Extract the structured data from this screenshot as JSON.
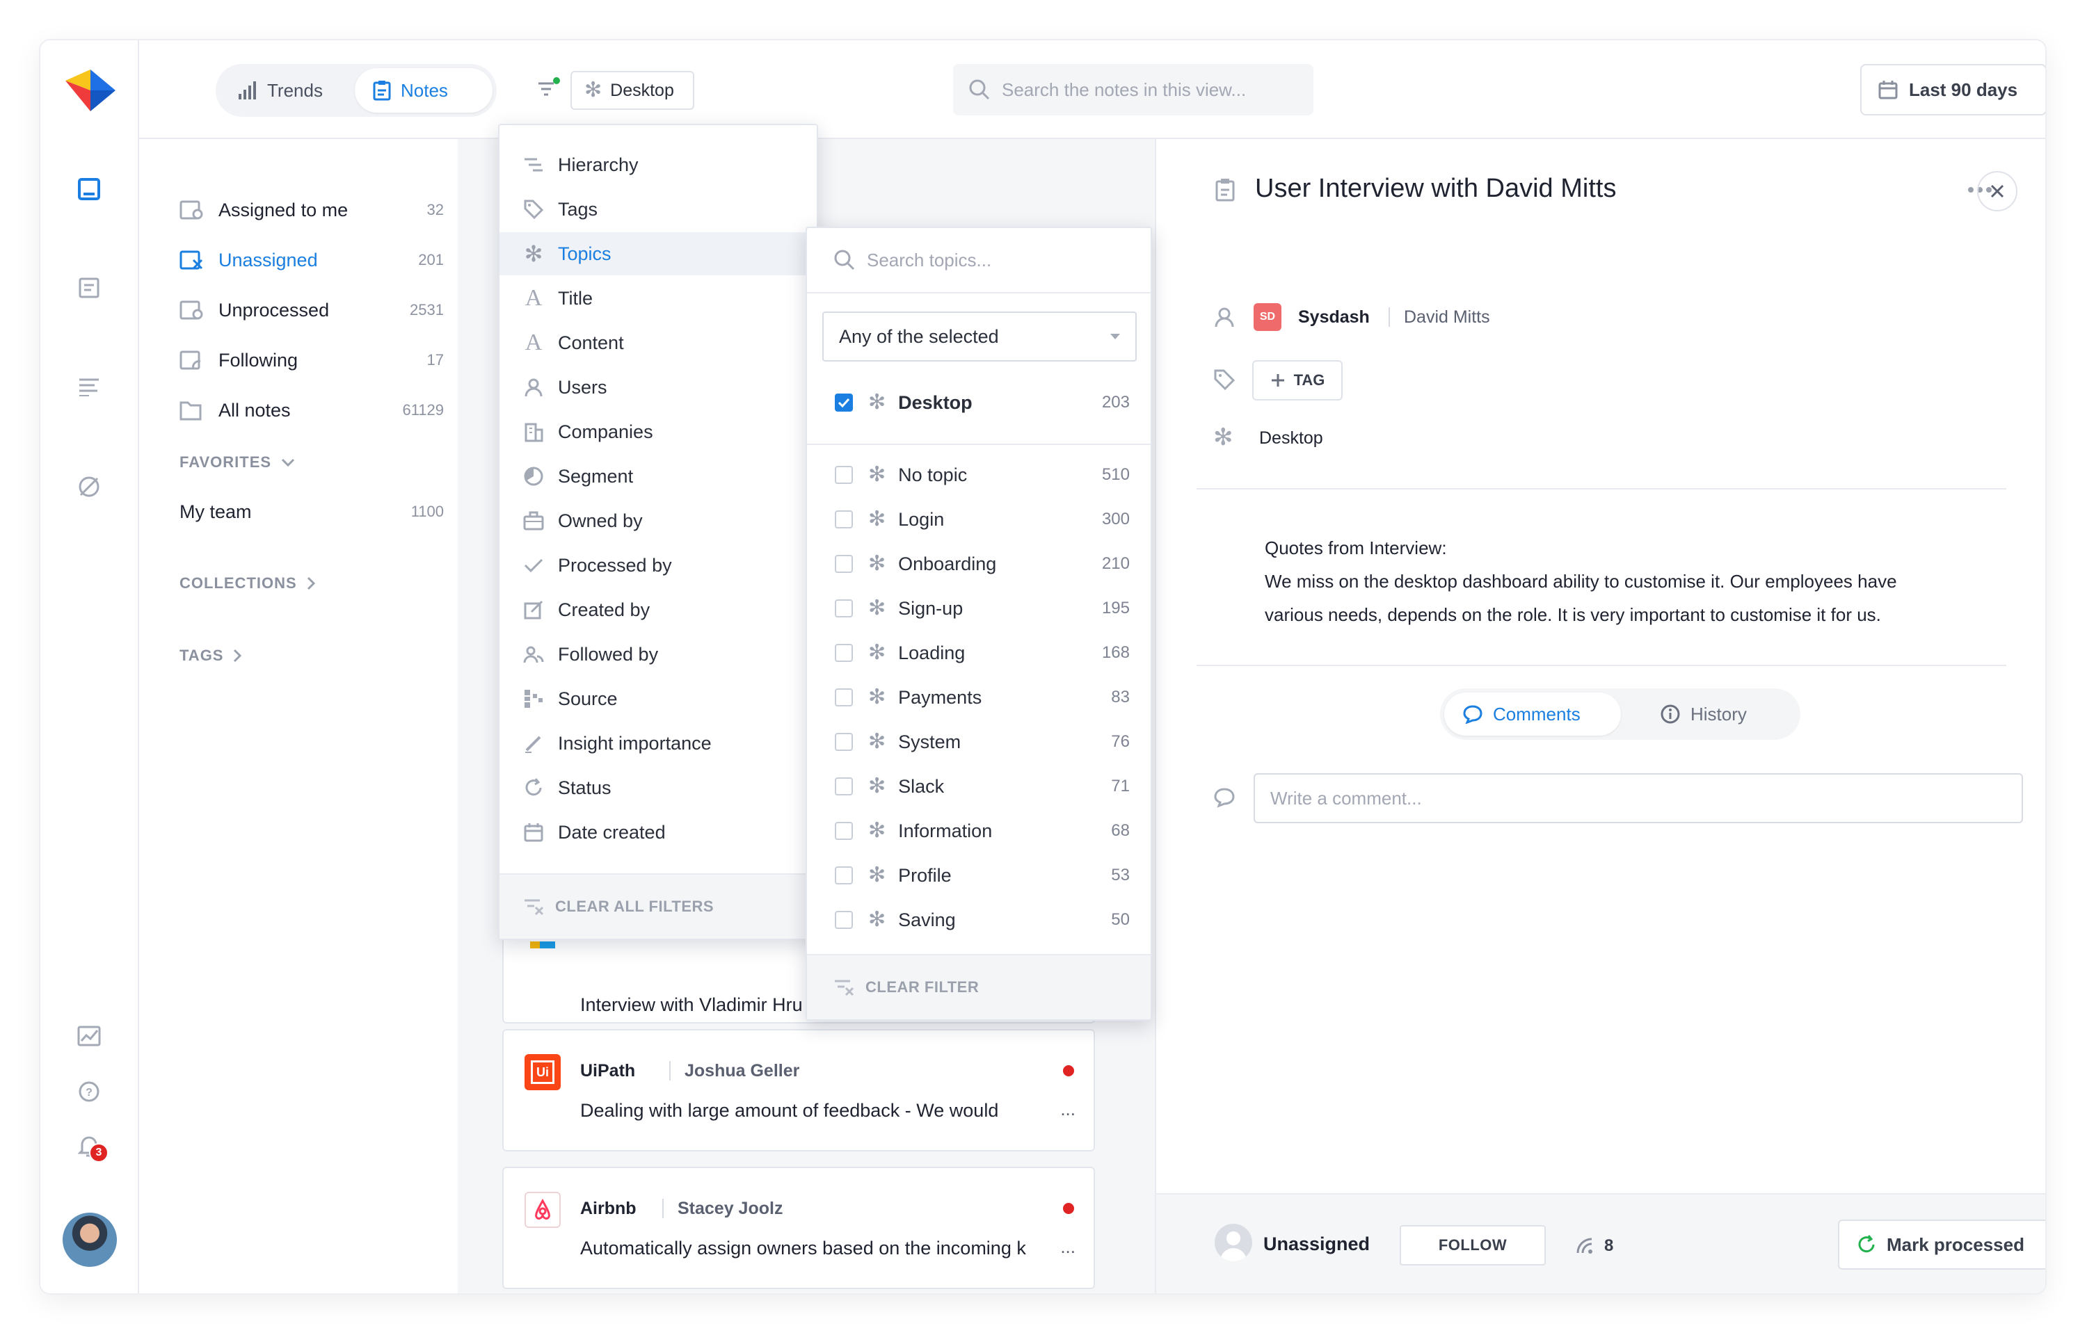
{
  "topbar": {
    "tabs": [
      {
        "label": "Trends",
        "icon": "bar-chart-icon",
        "active": false
      },
      {
        "label": "Notes",
        "icon": "clipboard-icon",
        "active": true
      }
    ],
    "filter_chip": {
      "label": "Desktop",
      "icon": "topic-snowflake-icon"
    },
    "search_placeholder": "Search the notes in this view...",
    "date_range": "Last 90 days"
  },
  "sidebar": {
    "items": [
      {
        "label": "Assigned to me",
        "count": "32",
        "icon": "inbox-user-icon"
      },
      {
        "label": "Unassigned",
        "count": "201",
        "icon": "inbox-x-icon",
        "active": true
      },
      {
        "label": "Unprocessed",
        "count": "2531",
        "icon": "inbox-clock-icon"
      },
      {
        "label": "Following",
        "count": "17",
        "icon": "inbox-follow-icon"
      },
      {
        "label": "All notes",
        "count": "61129",
        "icon": "folder-icon"
      }
    ],
    "favorites_header": "FAVORITES",
    "favorites": [
      {
        "label": "My team",
        "count": "1100"
      }
    ],
    "collections_header": "COLLECTIONS",
    "tags_header": "TAGS"
  },
  "filter_menu": {
    "options": [
      {
        "label": "Hierarchy",
        "icon": "hierarchy-icon"
      },
      {
        "label": "Tags",
        "icon": "tag-icon"
      },
      {
        "label": "Topics",
        "icon": "topic-snowflake-icon",
        "selected": true
      },
      {
        "label": "Title",
        "icon": "letter-a-icon"
      },
      {
        "label": "Content",
        "icon": "letter-a-icon"
      },
      {
        "label": "Users",
        "icon": "user-icon"
      },
      {
        "label": "Companies",
        "icon": "building-icon"
      },
      {
        "label": "Segment",
        "icon": "pie-icon"
      },
      {
        "label": "Owned by",
        "icon": "briefcase-icon"
      },
      {
        "label": "Processed by",
        "icon": "check-icon"
      },
      {
        "label": "Created by",
        "icon": "edit-icon"
      },
      {
        "label": "Followed by",
        "icon": "follow-icon"
      },
      {
        "label": "Source",
        "icon": "source-icon"
      },
      {
        "label": "Insight importance",
        "icon": "pen-icon"
      },
      {
        "label": "Status",
        "icon": "refresh-icon"
      },
      {
        "label": "Date created",
        "icon": "calendar-icon"
      }
    ],
    "clear_all": "CLEAR ALL FILTERS"
  },
  "topics_menu": {
    "search_placeholder": "Search topics...",
    "match_mode": "Any of the selected",
    "selected": [
      {
        "label": "Desktop",
        "count": "203",
        "checked": true
      }
    ],
    "topics": [
      {
        "label": "No topic",
        "count": "510"
      },
      {
        "label": "Login",
        "count": "300"
      },
      {
        "label": "Onboarding",
        "count": "210"
      },
      {
        "label": "Sign-up",
        "count": "195"
      },
      {
        "label": "Loading",
        "count": "168"
      },
      {
        "label": "Payments",
        "count": "83"
      },
      {
        "label": "System",
        "count": "76"
      },
      {
        "label": "Slack",
        "count": "71"
      },
      {
        "label": "Information",
        "count": "68"
      },
      {
        "label": "Profile",
        "count": "53"
      },
      {
        "label": "Saving",
        "count": "50"
      }
    ],
    "clear": "CLEAR FILTER"
  },
  "notes": [
    {
      "company": "",
      "person": "",
      "text": "Interview with Vladimir Hru",
      "unread": false
    },
    {
      "company": "UiPath",
      "person": "Joshua Geller",
      "text": "Dealing with large amount of feedback - We would",
      "more": "...",
      "unread": true
    },
    {
      "company": "Airbnb",
      "person": "Stacey Joolz",
      "text": "Automatically assign owners based on the incoming k",
      "more": "...",
      "unread": true
    }
  ],
  "detail": {
    "title": "User Interview with David Mitts",
    "company_logo": "SD",
    "company": "Sysdash",
    "person": "David Mitts",
    "tag_button": "TAG",
    "topic": "Desktop",
    "quote_lines": [
      "Quotes from Interview:",
      "We miss on the desktop dashboard ability to customise it. Our employees have",
      "various needs, depends on the role. It is very important to customise it for us."
    ],
    "tabs": [
      {
        "label": "Comments",
        "active": true
      },
      {
        "label": "History",
        "active": false
      }
    ],
    "comment_placeholder": "Write a comment...",
    "owner": "Unassigned",
    "follow_button": "FOLLOW",
    "followers": "8",
    "mark_button": "Mark processed"
  },
  "notifications": {
    "count": "3"
  },
  "colors": {
    "accent": "#1a7fe0",
    "unread": "#e02424",
    "brand_yellow": "#f7c51c",
    "brand_blue": "#1f6fe5",
    "brand_red": "#ef3b3b"
  }
}
